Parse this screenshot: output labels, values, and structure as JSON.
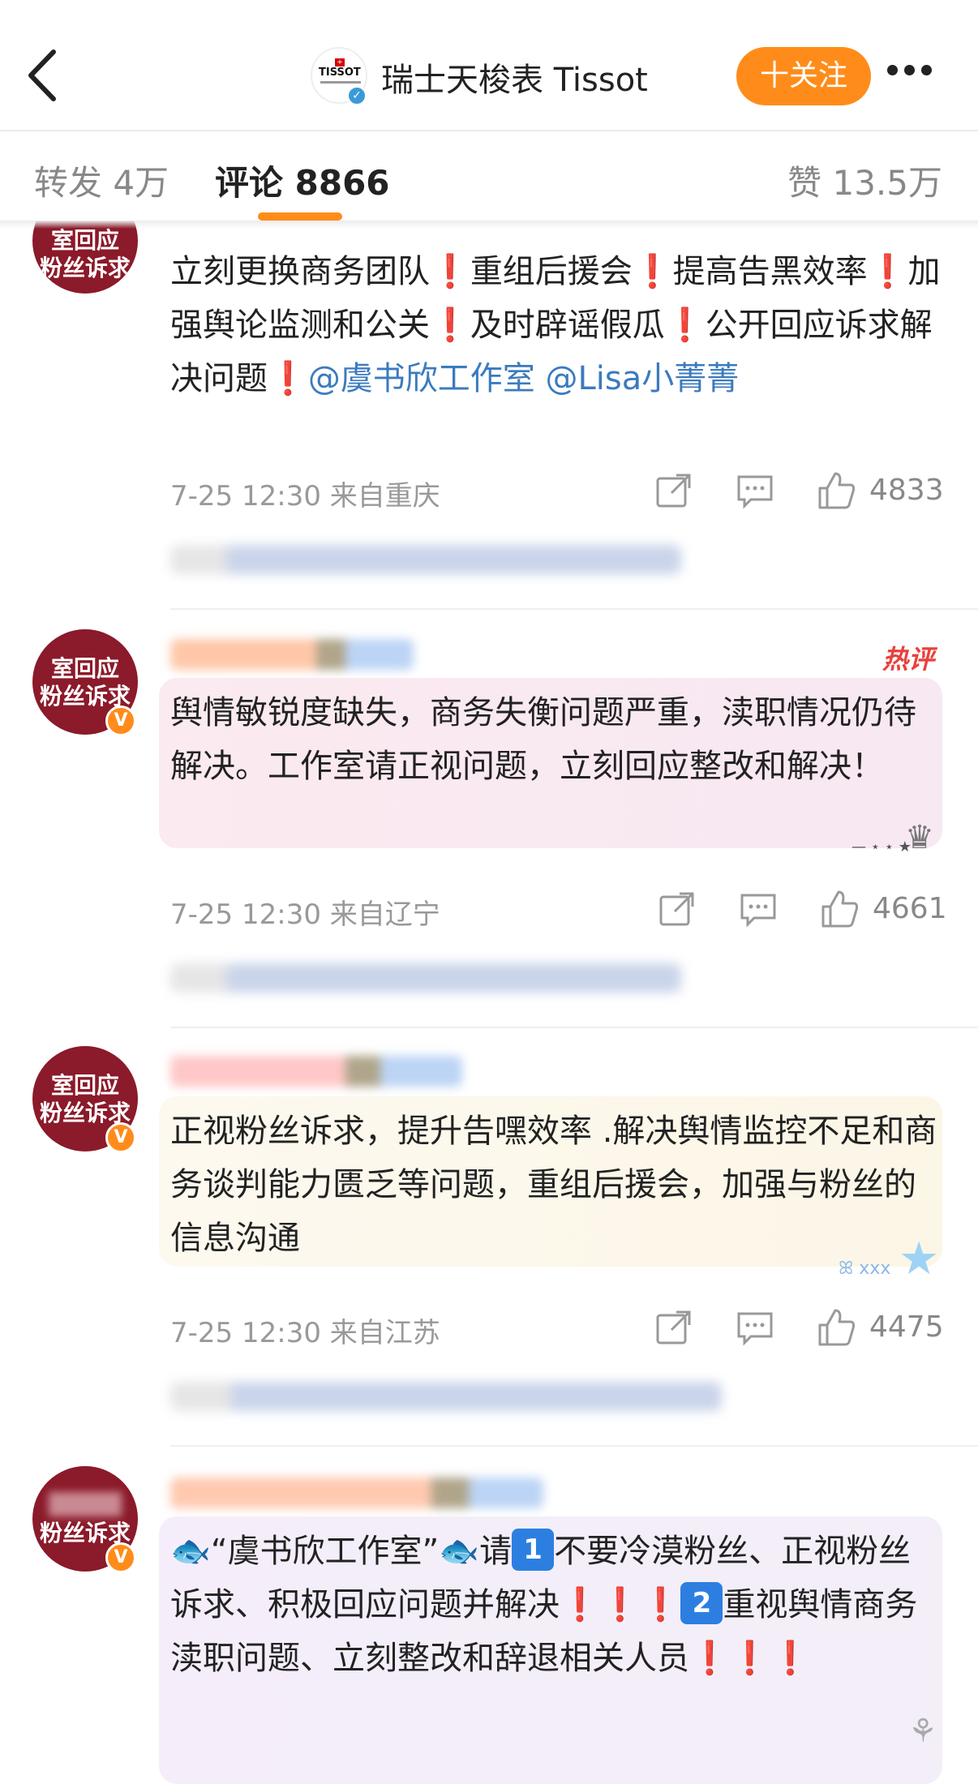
{
  "header": {
    "back_icon": "chevron-left-icon",
    "title": "瑞士天梭表 Tissot",
    "avatar_text": "TISSOT",
    "follow_label": "十关注",
    "more_icon": "more-dots-icon"
  },
  "tabs": {
    "repost": "转发 4万",
    "comments": "评论 8866",
    "likes": "赞 13.5万"
  },
  "comments": [
    {
      "avatar_l1": "室回应",
      "avatar_l2": "粉丝诉求",
      "segments": [
        "立刻更换商务团队",
        "❗",
        "重组后援会",
        "❗",
        "提高告黑效率",
        "❗",
        "加强舆论监测和公关",
        "❗",
        "及时辟谣假瓜",
        "❗",
        "公开回应诉求解决问题",
        "❗",
        "@虞书欣工作室 @Lisa小菁菁"
      ],
      "meta": "7-25 12:30 来自重庆",
      "likes": "4833"
    },
    {
      "avatar_l1": "室回应",
      "avatar_l2": "粉丝诉求",
      "hot_tag": "热评",
      "text": "舆情敏锐度缺失，商务失衡问题严重，渎职情况仍待解决。工作室请正视问题，立刻回应整改和解决！",
      "meta": "7-25 12:30 来自辽宁",
      "likes": "4661"
    },
    {
      "avatar_l1": "室回应",
      "avatar_l2": "粉丝诉求",
      "text": "正视粉丝诉求，提升告嘿效率 .解决舆情监控不足和商务谈判能力匮乏等问题，重组后援会，加强与粉丝的信息沟通",
      "meta": "7-25 12:30 来自江苏",
      "likes": "4475"
    },
    {
      "avatar_l1": "",
      "avatar_l2": "粉丝诉求",
      "parts": {
        "a": "“虞书欣工作室”",
        "b": "请",
        "n1": "1",
        "c": "不要冷漠粉丝、正视粉丝诉求、积极回应问题并解决",
        "n2": "2",
        "d": "重视舆情商务渎职问题、立刻整改和辞退相关人员",
        "ex": "❗"
      }
    }
  ]
}
